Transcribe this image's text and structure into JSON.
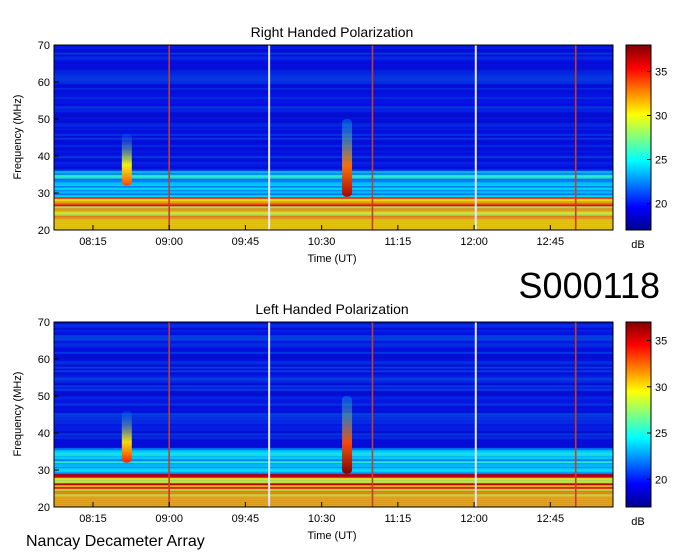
{
  "colors": {
    "scale": [
      "#00008f",
      "#0000ff",
      "#0080ff",
      "#00ffff",
      "#80ff80",
      "#ffff00",
      "#ff8000",
      "#ff0000",
      "#800000"
    ],
    "background": "#0a1cc4",
    "marker": "#c83c28",
    "gap": "#e8e8ff"
  },
  "observation_id": "S000118",
  "instrument": "Nancay Decameter Array",
  "chart_data": [
    {
      "type": "heatmap",
      "title": "Right Handed Polarization",
      "xlabel": "Time (UT)",
      "ylabel": "Frequency (MHz)",
      "xlim": [
        "07:52",
        "13:22"
      ],
      "ylim": [
        20,
        70
      ],
      "x_ticks": [
        "08:15",
        "09:00",
        "09:45",
        "10:30",
        "11:15",
        "12:00",
        "12:45"
      ],
      "y_ticks": [
        20,
        30,
        40,
        50,
        60,
        70
      ],
      "colorbar": {
        "label": "dB",
        "ticks": [
          20,
          25,
          30,
          35
        ],
        "range": [
          17,
          38
        ]
      },
      "vertical_markers": [
        "09:00",
        "11:00",
        "13:00"
      ],
      "data_gaps": [
        "09:59",
        "12:01"
      ],
      "bursts": [
        {
          "time": "10:45",
          "fmin": 29,
          "fmax": 50,
          "level_db": 33
        },
        {
          "time": "08:35",
          "fmin": 32,
          "fmax": 46,
          "level_db": 30
        }
      ]
    },
    {
      "type": "heatmap",
      "title": "Left Handed Polarization",
      "xlabel": "Time (UT)",
      "ylabel": "Frequency (MHz)",
      "xlim": [
        "07:52",
        "13:22"
      ],
      "ylim": [
        20,
        70
      ],
      "x_ticks": [
        "08:15",
        "09:00",
        "09:45",
        "10:30",
        "11:15",
        "12:00",
        "12:45"
      ],
      "y_ticks": [
        20,
        30,
        40,
        50,
        60,
        70
      ],
      "colorbar": {
        "label": "dB",
        "ticks": [
          20,
          25,
          30,
          35
        ],
        "range": [
          17,
          37
        ]
      },
      "vertical_markers": [
        "09:00",
        "11:00",
        "13:00"
      ],
      "data_gaps": [
        "09:59",
        "12:01"
      ],
      "bursts": [
        {
          "time": "10:45",
          "fmin": 29,
          "fmax": 50,
          "level_db": 33
        },
        {
          "time": "08:35",
          "fmin": 32,
          "fmax": 46,
          "level_db": 30
        }
      ]
    }
  ]
}
